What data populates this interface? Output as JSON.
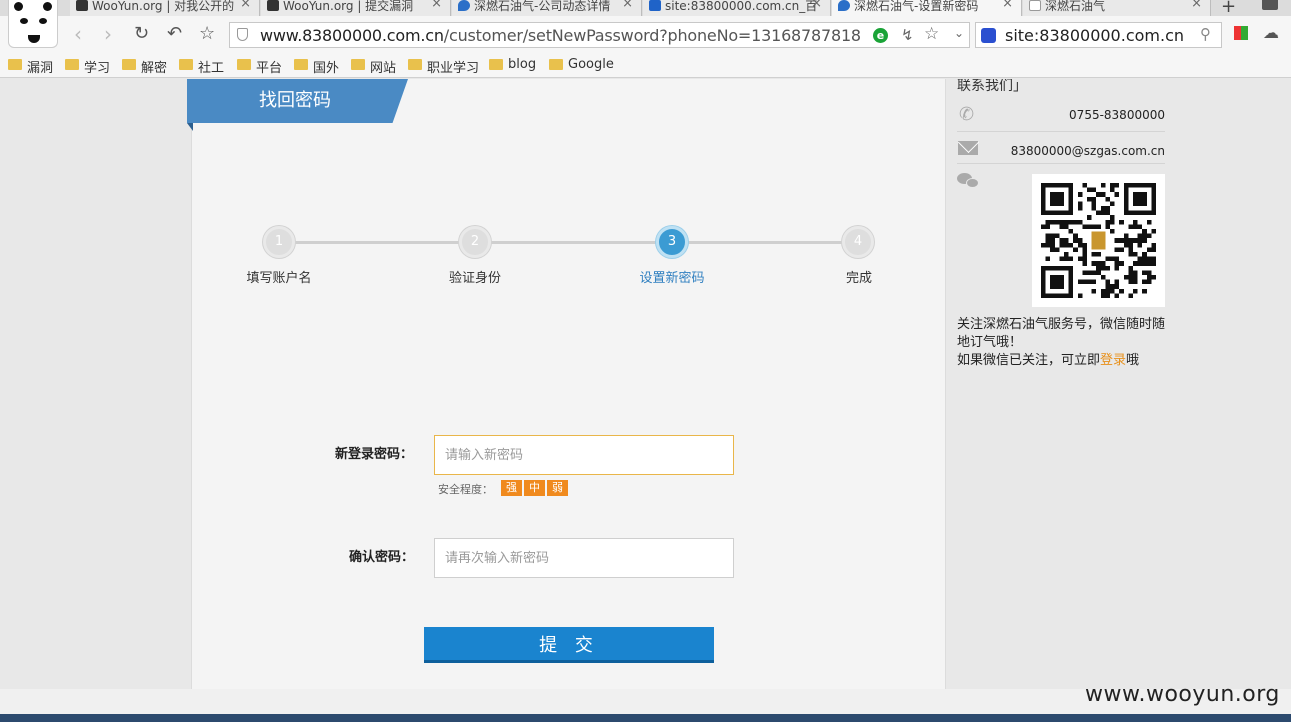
{
  "browser": {
    "tabs": [
      {
        "title": "WooYun.org | 对我公开的",
        "favicon": "wooyun-icon"
      },
      {
        "title": "WooYun.org | 提交漏洞",
        "favicon": "wooyun-icon"
      },
      {
        "title": "深燃石油气-公司动态详情",
        "favicon": "gas-drop-icon"
      },
      {
        "title": "site:83800000.com.cn_百",
        "favicon": "baidu-icon"
      },
      {
        "title": "深燃石油气-设置新密码",
        "favicon": "gas-drop-icon"
      },
      {
        "title": "深燃石油气",
        "favicon": "page-icon"
      }
    ],
    "url_host": "www.83800000.com.cn",
    "url_path": "/customer/setNewPassword?phoneNo=13168787818",
    "search_value": "site:83800000.com.cn",
    "bookmarks": [
      "漏洞",
      "学习",
      "解密",
      "社工",
      "平台",
      "国外",
      "网站",
      "职业学习",
      "blog",
      "Google"
    ]
  },
  "main": {
    "title": "找回密码",
    "steps": [
      {
        "num": "1",
        "label": "填写账户名"
      },
      {
        "num": "2",
        "label": "验证身份"
      },
      {
        "num": "3",
        "label": "设置新密码"
      },
      {
        "num": "4",
        "label": "完成"
      }
    ],
    "active_step": 3,
    "form": {
      "new_password_label": "新登录密码：",
      "new_password_placeholder": "请输入新密码",
      "strength_label": "安全程度：",
      "strength_levels": [
        "强",
        "中",
        "弱"
      ],
      "confirm_label": "确认密码：",
      "confirm_placeholder": "请再次输入新密码",
      "submit_label": "提 交"
    }
  },
  "sidebar": {
    "heading": "联系我们",
    "phone": "0755-83800000",
    "email": "83800000@szgas.com.cn",
    "follow_text_1": "关注深燃石油气服务号，微信随时随地订气哦！",
    "follow_text_2a": "如果微信已关注，可立即",
    "follow_link": "登录",
    "follow_text_2b": "哦"
  },
  "watermark": "www.wooyun.org",
  "colors": {
    "accent_blue": "#4a8ac4",
    "button_blue": "#1a84cf",
    "strength_orange": "#f08a1e",
    "link_orange": "#e8901a"
  }
}
